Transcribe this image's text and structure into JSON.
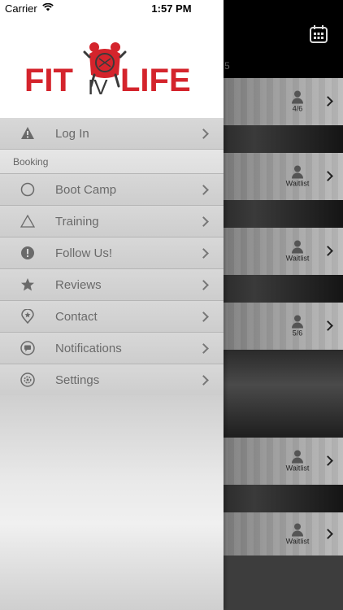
{
  "status_bar": {
    "carrier": "Carrier",
    "time": "1:57 PM"
  },
  "brand": {
    "left": "FIT",
    "middle": "IV",
    "right": "LIFE",
    "accent": "#d4242c",
    "dark": "#3a3a3a"
  },
  "background": {
    "date_fragment": "5",
    "cards": [
      {
        "status": "4/6"
      },
      {
        "status": "Waitlist"
      },
      {
        "status": "Waitlist"
      },
      {
        "status": "5/6"
      },
      {
        "status": "Waitlist"
      },
      {
        "status": "Waitlist"
      }
    ]
  },
  "menu": {
    "login": {
      "label": "Log In",
      "icon": "warning-icon"
    },
    "section_label": "Booking",
    "items": [
      {
        "label": "Boot Camp",
        "icon": "circle-icon"
      },
      {
        "label": "Training",
        "icon": "triangle-icon"
      },
      {
        "label": "Follow Us!",
        "icon": "exclamation-icon"
      },
      {
        "label": "Reviews",
        "icon": "star-icon"
      },
      {
        "label": "Contact",
        "icon": "location-pin-icon"
      },
      {
        "label": "Notifications",
        "icon": "chat-bubble-icon"
      },
      {
        "label": "Settings",
        "icon": "gear-icon"
      }
    ]
  }
}
